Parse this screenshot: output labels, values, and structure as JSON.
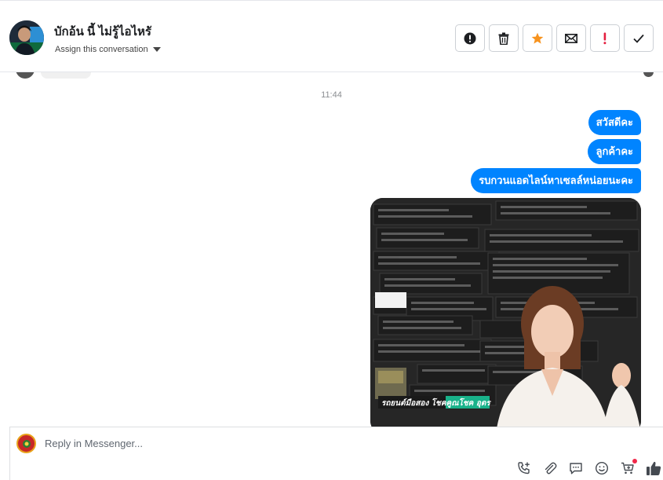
{
  "header": {
    "contact_name": "บักอ้น นี้ ไม่รู้ไอไหรั",
    "assign_label": "Assign this conversation",
    "actions": [
      {
        "name": "spam-button",
        "icon": "exclamation-circle-icon"
      },
      {
        "name": "delete-button",
        "icon": "trash-icon"
      },
      {
        "name": "star-button",
        "icon": "star-icon",
        "color": "#f7931e"
      },
      {
        "name": "mark-unread-button",
        "icon": "envelope-icon"
      },
      {
        "name": "important-button",
        "icon": "exclamation-icon",
        "color": "#e41e3f"
      },
      {
        "name": "mark-done-button",
        "icon": "check-icon"
      }
    ]
  },
  "conversation": {
    "timestamp": "11:44",
    "messages": [
      {
        "from": "page",
        "text": "สวัสดีคะ"
      },
      {
        "from": "page",
        "text": "ลูกค้าคะ"
      },
      {
        "from": "page",
        "text": "รบกวนแอดไลน์หาเซลล์หน่อยนะคะ"
      }
    ],
    "image_caption": "รถยนต์มือสอง โชคคูณโชค อุดร"
  },
  "composer": {
    "placeholder": "Reply in Messenger...",
    "tools": [
      "add-call-icon",
      "attachment-icon",
      "saved-reply-icon",
      "emoji-icon",
      "cart-icon",
      "thumbs-up-icon"
    ]
  },
  "colors": {
    "accent": "#0084ff",
    "star": "#f7931e",
    "alert": "#e41e3f"
  }
}
